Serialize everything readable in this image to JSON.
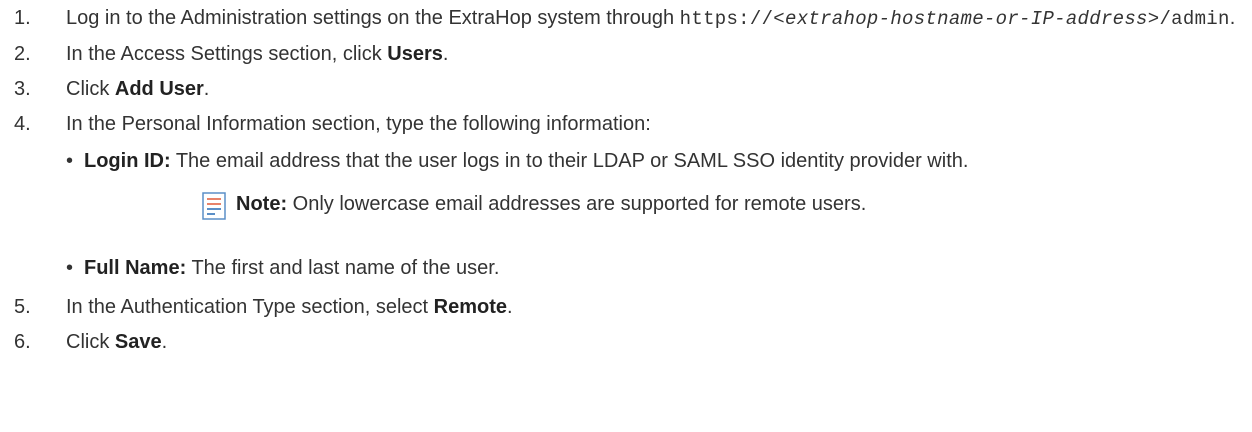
{
  "steps": [
    {
      "num": "1.",
      "pre": "Log in to the Administration settings on the ExtraHop system through ",
      "code1": "https://<",
      "code_italic": "extrahop-hostname-or-IP-address",
      "code2": ">/admin",
      "post": "."
    },
    {
      "num": "2.",
      "pre": "In the Access Settings section, click ",
      "bold": "Users",
      "post": "."
    },
    {
      "num": "3.",
      "pre": "Click ",
      "bold": "Add User",
      "post": "."
    },
    {
      "num": "4.",
      "pre": "In the Personal Information section, type the following information:",
      "sub": [
        {
          "bullet": "•",
          "label": "Login ID:",
          "text": " The email address that the user logs in to their LDAP or SAML SSO identity provider with."
        },
        {
          "bullet": "•",
          "label": "Full Name:",
          "text": " The first and last name of the user."
        }
      ],
      "note": {
        "label": "Note:",
        "text": "  Only lowercase email addresses are supported for remote users."
      }
    },
    {
      "num": "5.",
      "pre": "In the Authentication Type section, select ",
      "bold": "Remote",
      "post": "."
    },
    {
      "num": "6.",
      "pre": "Click ",
      "bold": "Save",
      "post": "."
    }
  ],
  "icons": {
    "note": "note-document-icon"
  },
  "colors": {
    "text": "#333333",
    "note_icon_lines": "#e8836a",
    "note_icon_border": "#5b8fc7"
  }
}
